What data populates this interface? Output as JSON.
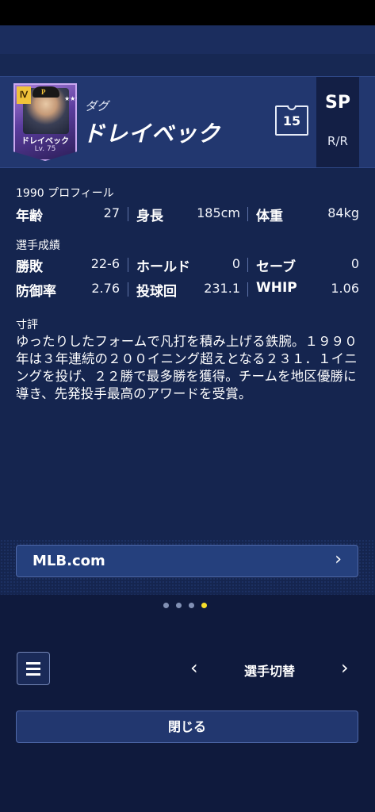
{
  "player": {
    "first_name": "ダグ",
    "last_name": "ドレイベック",
    "jersey_number": "15",
    "position": "SP",
    "handedness": "R/R",
    "card": {
      "rank": "Ⅳ",
      "logo": "P",
      "stars": "★★★★★★",
      "name": "ドレイベック",
      "level": "Lv. 75"
    }
  },
  "profile": {
    "section_label": "1990 プロフィール",
    "rows": [
      [
        {
          "label": "年齢",
          "value": "27"
        },
        {
          "label": "身長",
          "value": "185cm"
        },
        {
          "label": "体重",
          "value": "84kg"
        }
      ]
    ]
  },
  "stats": {
    "section_label": "選手成績",
    "rows": [
      [
        {
          "label": "勝敗",
          "value": "22-6"
        },
        {
          "label": "ホールド",
          "value": "0"
        },
        {
          "label": "セーブ",
          "value": "0"
        }
      ],
      [
        {
          "label": "防御率",
          "value": "2.76"
        },
        {
          "label": "投球回",
          "value": "231.1"
        },
        {
          "label": "WHIP",
          "value": "1.06"
        }
      ]
    ]
  },
  "comment": {
    "label": "寸評",
    "text": "ゆったりしたフォームで凡打を積み上げる鉄腕。１９９０年は３年連続の２００イニング超えとなる２３１．１イニングを投げ、２２勝で最多勝を獲得。チームを地区優勝に導き、先発投手最高のアワードを受賞。"
  },
  "links": {
    "mlb_label": "MLB.com",
    "chevron": "›"
  },
  "pagination": {
    "pages": 4,
    "active_index": 3
  },
  "footer": {
    "prev": "‹",
    "switch_label": "選手切替",
    "next": "›",
    "close_label": "閉じる"
  },
  "colors": {
    "background": "#15254f",
    "header": "#22376f",
    "active_dot": "#f5de2a"
  }
}
